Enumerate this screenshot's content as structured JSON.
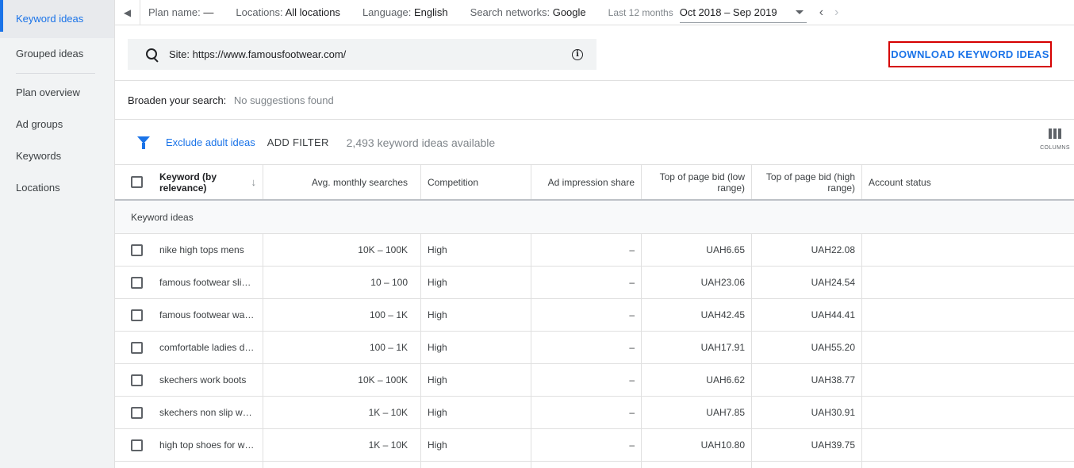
{
  "sidebar": {
    "items": [
      {
        "label": "Keyword ideas"
      },
      {
        "label": "Grouped ideas"
      },
      {
        "label": "Plan overview"
      },
      {
        "label": "Ad groups"
      },
      {
        "label": "Keywords"
      },
      {
        "label": "Locations"
      }
    ]
  },
  "topbar": {
    "plan_label": "Plan name:",
    "plan_value": "—",
    "locations_label": "Locations:",
    "locations_value": "All locations",
    "language_label": "Language:",
    "language_value": "English",
    "networks_label": "Search networks:",
    "networks_value": "Google",
    "period_label": "Last 12 months",
    "period_value": "Oct 2018 – Sep 2019"
  },
  "search": {
    "value": "Site: https://www.famousfootwear.com/"
  },
  "download_button": "DOWNLOAD KEYWORD IDEAS",
  "broaden": {
    "label": "Broaden your search:",
    "value": "No suggestions found"
  },
  "filter": {
    "exclude_label": "Exclude adult ideas",
    "add_filter_label": "ADD FILTER",
    "available_text": "2,493 keyword ideas available",
    "columns_label": "COLUMNS"
  },
  "table": {
    "headers": {
      "keyword": "Keyword (by relevance)",
      "avg": "Avg. monthly searches",
      "competition": "Competition",
      "impression": "Ad impression share",
      "low": "Top of page bid (low range)",
      "high": "Top of page bid (high range)",
      "account": "Account status"
    },
    "group_label": "Keyword ideas",
    "rows": [
      {
        "keyword": "nike high tops mens",
        "avg": "10K – 100K",
        "competition": "High",
        "impression": "–",
        "low": "UAH6.65",
        "high": "UAH22.08"
      },
      {
        "keyword": "famous footwear slip…",
        "avg": "10 – 100",
        "competition": "High",
        "impression": "–",
        "low": "UAH23.06",
        "high": "UAH24.54"
      },
      {
        "keyword": "famous footwear wa…",
        "avg": "100 – 1K",
        "competition": "High",
        "impression": "–",
        "low": "UAH42.45",
        "high": "UAH44.41"
      },
      {
        "keyword": "comfortable ladies dr…",
        "avg": "100 – 1K",
        "competition": "High",
        "impression": "–",
        "low": "UAH17.91",
        "high": "UAH55.20"
      },
      {
        "keyword": "skechers work boots",
        "avg": "10K – 100K",
        "competition": "High",
        "impression": "–",
        "low": "UAH6.62",
        "high": "UAH38.77"
      },
      {
        "keyword": "skechers non slip wo…",
        "avg": "1K – 10K",
        "competition": "High",
        "impression": "–",
        "low": "UAH7.85",
        "high": "UAH30.91"
      },
      {
        "keyword": "high top shoes for w…",
        "avg": "1K – 10K",
        "competition": "High",
        "impression": "–",
        "low": "UAH10.80",
        "high": "UAH39.75"
      }
    ]
  },
  "colors": {
    "accent": "#1a73e8",
    "highlight_border": "#d50000"
  }
}
